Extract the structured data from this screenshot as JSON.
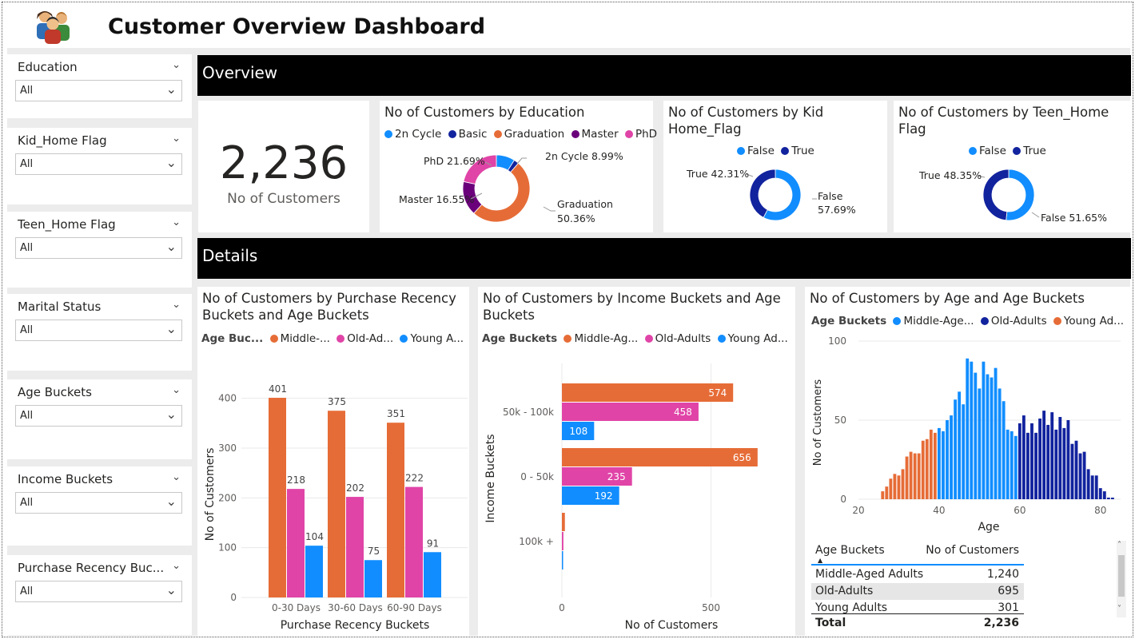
{
  "header": {
    "title": "Customer Overview Dashboard",
    "logo_icon": "customers-group-icon"
  },
  "slicers": [
    {
      "label": "Education",
      "value": "All"
    },
    {
      "label": "Kid_Home Flag",
      "value": "All"
    },
    {
      "label": "Teen_Home Flag",
      "value": "All"
    },
    {
      "label": "Marital Status",
      "value": "All"
    },
    {
      "label": "Age Buckets",
      "value": "All"
    },
    {
      "label": "Income Buckets",
      "value": "All"
    },
    {
      "label": "Purchase Recency Buc...",
      "value": "All"
    }
  ],
  "sections": {
    "overview": "Overview",
    "details": "Details"
  },
  "kpi": {
    "value": "2,236",
    "label": "No of Customers"
  },
  "colors": {
    "blue": "#118DFF",
    "navy": "#12239E",
    "orange": "#E66C37",
    "purple": "#6B007B",
    "pink": "#E044A7"
  },
  "education_donut": {
    "title": "No of Customers by Education",
    "legend": [
      "2n Cycle",
      "Basic",
      "Graduation",
      "Master",
      "PhD"
    ],
    "labels": {
      "cycle": "2n Cycle 8.99%",
      "phd": "PhD 21.69%",
      "master": "Master 16.55%",
      "grad1": "Graduation",
      "grad2": "50.36%"
    },
    "chart_data": {
      "type": "pie",
      "categories": [
        "2n Cycle",
        "Basic",
        "Graduation",
        "Master",
        "PhD"
      ],
      "values": [
        8.99,
        2.41,
        50.36,
        16.55,
        21.69
      ]
    }
  },
  "kid_donut": {
    "title1": "No of Customers by Kid",
    "title2": "Home_Flag",
    "legend": [
      "False",
      "True"
    ],
    "labels": {
      "true": "True 42.31%",
      "false1": "False",
      "false2": "57.69%"
    },
    "chart_data": {
      "type": "pie",
      "categories": [
        "False",
        "True"
      ],
      "values": [
        57.69,
        42.31
      ]
    }
  },
  "teen_donut": {
    "title1": "No of Customers by Teen_Home",
    "title2": "Flag",
    "legend": [
      "False",
      "True"
    ],
    "labels": {
      "true": "True 48.35%",
      "false": "False 51.65%"
    },
    "chart_data": {
      "type": "pie",
      "categories": [
        "False",
        "True"
      ],
      "values": [
        51.65,
        48.35
      ]
    }
  },
  "recency_chart": {
    "title1": "No of Customers by Purchase Recency",
    "title2": "Buckets and Age Buckets",
    "legend_title": "Age Buc...",
    "legend": [
      "Middle-...",
      "Old-Ad...",
      "Young A..."
    ],
    "chart_data": {
      "type": "bar",
      "title": "No of Customers by Purchase Recency Buckets and Age Buckets",
      "xlabel": "Purchase Recency Buckets",
      "ylabel": "No of Customers",
      "categories": [
        "0-30 Days",
        "30-60 Days",
        "60-90 Days"
      ],
      "series": [
        {
          "name": "Middle-Aged Adults",
          "values": [
            401,
            375,
            351
          ]
        },
        {
          "name": "Old-Adults",
          "values": [
            218,
            202,
            222
          ]
        },
        {
          "name": "Young Adults",
          "values": [
            104,
            75,
            91
          ]
        }
      ],
      "ylim": [
        0,
        470
      ],
      "yticks": [
        0,
        100,
        200,
        300,
        400
      ]
    }
  },
  "income_chart": {
    "title1": "No of Customers by Income Buckets and Age",
    "title2": "Buckets",
    "legend_title": "Age Buckets",
    "legend": [
      "Middle-Ag...",
      "Old-Adults",
      "Young Ad..."
    ],
    "chart_data": {
      "type": "bar",
      "orientation": "horizontal",
      "title": "No of Customers by Income Buckets and Age Buckets",
      "xlabel": "No of Customers",
      "ylabel": "Income Buckets",
      "categories": [
        "50k - 100k",
        "0 - 50k",
        "100k +"
      ],
      "series": [
        {
          "name": "Middle-Aged Adults",
          "values": [
            574,
            656,
            10
          ]
        },
        {
          "name": "Old-Adults",
          "values": [
            458,
            235,
            5
          ]
        },
        {
          "name": "Young Adults",
          "values": [
            108,
            192,
            3
          ]
        }
      ],
      "xticks": [
        0,
        500
      ]
    }
  },
  "age_chart": {
    "title": "No of Customers by Age and Age Buckets",
    "legend_title": "Age Buckets",
    "legend": [
      "Middle-Age...",
      "Old-Adults",
      "Young Ad..."
    ],
    "chart_data": {
      "type": "bar",
      "title": "No of Customers by Age and Age Buckets",
      "xlabel": "Age",
      "ylabel": "No of Customers",
      "ages": [
        26,
        27,
        28,
        29,
        30,
        31,
        32,
        33,
        34,
        35,
        36,
        37,
        38,
        39,
        40,
        41,
        42,
        43,
        44,
        45,
        46,
        47,
        48,
        49,
        50,
        51,
        52,
        53,
        54,
        55,
        56,
        57,
        58,
        59,
        60,
        61,
        62,
        63,
        64,
        65,
        66,
        67,
        68,
        69,
        70,
        71,
        72,
        73,
        74,
        75,
        76,
        77,
        78,
        79,
        80,
        81,
        82,
        83
      ],
      "values": [
        5,
        8,
        13,
        16,
        15,
        19,
        27,
        30,
        29,
        29,
        37,
        38,
        44,
        42,
        45,
        43,
        50,
        53,
        63,
        68,
        60,
        89,
        87,
        80,
        70,
        87,
        79,
        77,
        83,
        70,
        62,
        44,
        43,
        40,
        48,
        53,
        42,
        48,
        42,
        51,
        56,
        47,
        55,
        44,
        52,
        45,
        50,
        35,
        37,
        29,
        30,
        19,
        15,
        15,
        7,
        5,
        1,
        1
      ],
      "buckets": [
        "Young Adults",
        "Young Adults",
        "Young Adults",
        "Young Adults",
        "Young Adults",
        "Young Adults",
        "Young Adults",
        "Young Adults",
        "Young Adults",
        "Young Adults",
        "Young Adults",
        "Young Adults",
        "Young Adults",
        "Young Adults",
        "Middle-Aged Adults",
        "Middle-Aged Adults",
        "Middle-Aged Adults",
        "Middle-Aged Adults",
        "Middle-Aged Adults",
        "Middle-Aged Adults",
        "Middle-Aged Adults",
        "Middle-Aged Adults",
        "Middle-Aged Adults",
        "Middle-Aged Adults",
        "Middle-Aged Adults",
        "Middle-Aged Adults",
        "Middle-Aged Adults",
        "Middle-Aged Adults",
        "Middle-Aged Adults",
        "Middle-Aged Adults",
        "Middle-Aged Adults",
        "Middle-Aged Adults",
        "Middle-Aged Adults",
        "Middle-Aged Adults",
        "Old-Adults",
        "Old-Adults",
        "Old-Adults",
        "Old-Adults",
        "Old-Adults",
        "Old-Adults",
        "Old-Adults",
        "Old-Adults",
        "Old-Adults",
        "Old-Adults",
        "Old-Adults",
        "Old-Adults",
        "Old-Adults",
        "Old-Adults",
        "Old-Adults",
        "Old-Adults",
        "Old-Adults",
        "Old-Adults",
        "Old-Adults",
        "Old-Adults",
        "Old-Adults",
        "Old-Adults",
        "Old-Adults",
        "Old-Adults"
      ],
      "xlim": [
        20,
        85
      ],
      "ylim": [
        0,
        100
      ],
      "xticks": [
        20,
        40,
        60,
        80
      ],
      "yticks": [
        0,
        50,
        100
      ]
    }
  },
  "age_table": {
    "headers": [
      "Age Buckets",
      "No of Customers"
    ],
    "rows": [
      {
        "bucket": "Middle-Aged Adults",
        "count": "1,240"
      },
      {
        "bucket": "Old-Adults",
        "count": "695"
      },
      {
        "bucket": "Young Adults",
        "count": "301"
      }
    ],
    "total_label": "Total",
    "total_value": "2,236"
  }
}
